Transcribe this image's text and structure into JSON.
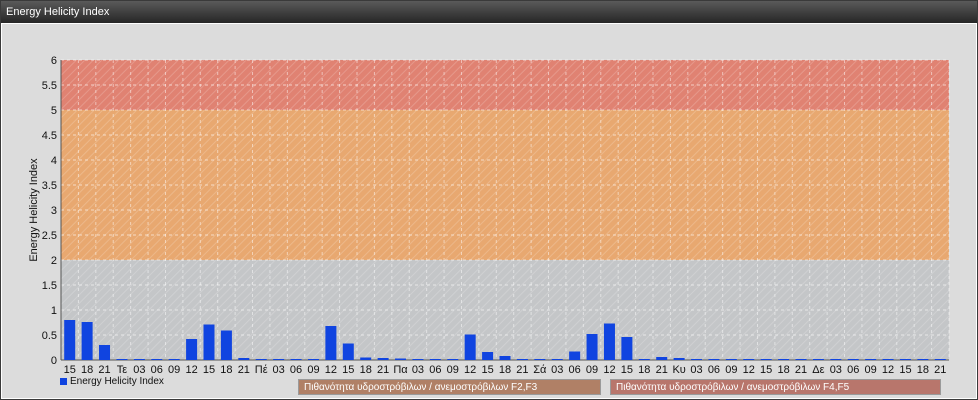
{
  "window": {
    "title": "Energy Helicity Index"
  },
  "chart_data": {
    "type": "bar",
    "ylabel": "Energy Helicity Index",
    "ylim": [
      0,
      6
    ],
    "yticks": [
      "0",
      "0.5",
      "1",
      "1.5",
      "2",
      "2.5",
      "3",
      "3.5",
      "4",
      "4.5",
      "5",
      "5.5",
      "6"
    ],
    "bands": [
      {
        "from": 2,
        "to": 5,
        "color": "#e8a870",
        "label": "Πιθανότητα υδροστρόβιλων / ανεμοστρόβιλων F2,F3"
      },
      {
        "from": 5,
        "to": 6,
        "color": "#e08272",
        "label": "Πιθανότητα υδροστρόβιλων / ανεμοστρόβιλων F4,F5"
      }
    ],
    "categories": [
      "15",
      "18",
      "21",
      "Τε",
      "03",
      "06",
      "09",
      "12",
      "15",
      "18",
      "21",
      "Πέ",
      "03",
      "06",
      "09",
      "12",
      "15",
      "18",
      "21",
      "Πα",
      "03",
      "06",
      "09",
      "12",
      "15",
      "18",
      "21",
      "Σά",
      "03",
      "06",
      "09",
      "12",
      "15",
      "18",
      "21",
      "Κυ",
      "03",
      "06",
      "09",
      "12",
      "15",
      "18",
      "21",
      "Δε",
      "03",
      "06",
      "09",
      "12",
      "15",
      "18",
      "21"
    ],
    "series": [
      {
        "name": "Energy Helicity Index",
        "color": "#1044e0",
        "values": [
          0.8,
          0.76,
          0.3,
          0.02,
          0.02,
          0.02,
          0.02,
          0.42,
          0.71,
          0.59,
          0.04,
          0.02,
          0.02,
          0.02,
          0.02,
          0.68,
          0.33,
          0.05,
          0.04,
          0.03,
          0.02,
          0.02,
          0.02,
          0.51,
          0.16,
          0.08,
          0.02,
          0.02,
          0.02,
          0.17,
          0.52,
          0.73,
          0.46,
          0.02,
          0.06,
          0.04,
          0.02,
          0.02,
          0.02,
          0.02,
          0.02,
          0.02,
          0.02,
          0.02,
          0.02,
          0.02,
          0.02,
          0.02,
          0.02,
          0.02,
          0.02
        ]
      }
    ],
    "grid": true,
    "legend": "bottom-left"
  }
}
